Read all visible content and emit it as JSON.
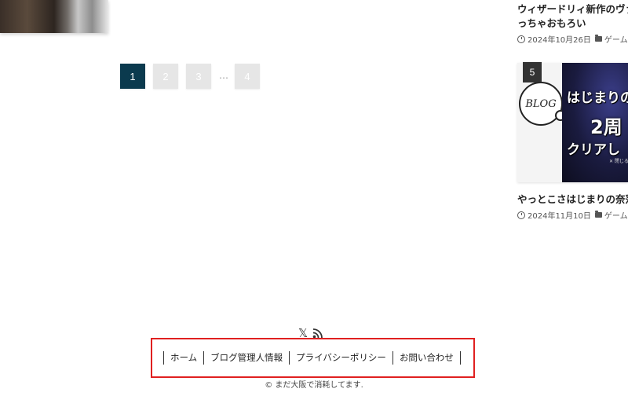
{
  "pagination": {
    "pages": [
      "1",
      "2",
      "3",
      "4"
    ],
    "current": "1",
    "ellipsis": "…"
  },
  "sidebar": {
    "cards": [
      {
        "title_lines": [
          "ウィザードリィ新作のヴァ",
          "っちゃおもろい"
        ],
        "date": "2024年10月26日",
        "category": "ゲーム"
      },
      {
        "rank": "5",
        "image_text": {
          "badge": "BLOG",
          "line1": "はじまりの",
          "line2": "2周",
          "line3": "クリアし",
          "sub": "✕ 閉じる"
        },
        "title": "やっとこさはじまりの奈落",
        "date": "2024年11月10日",
        "category": "ゲーム"
      }
    ]
  },
  "footer": {
    "social": [
      "x-icon",
      "rss-icon"
    ],
    "menu": [
      "ホーム",
      "ブログ管理人情報",
      "プライバシーポリシー",
      "お問い合わせ"
    ],
    "copyright": "© まだ大阪で消耗してます."
  },
  "colors": {
    "pagination_current": "#0b3a4e",
    "pagination_other": "#e6e6e6",
    "highlight_border": "#e02020"
  }
}
